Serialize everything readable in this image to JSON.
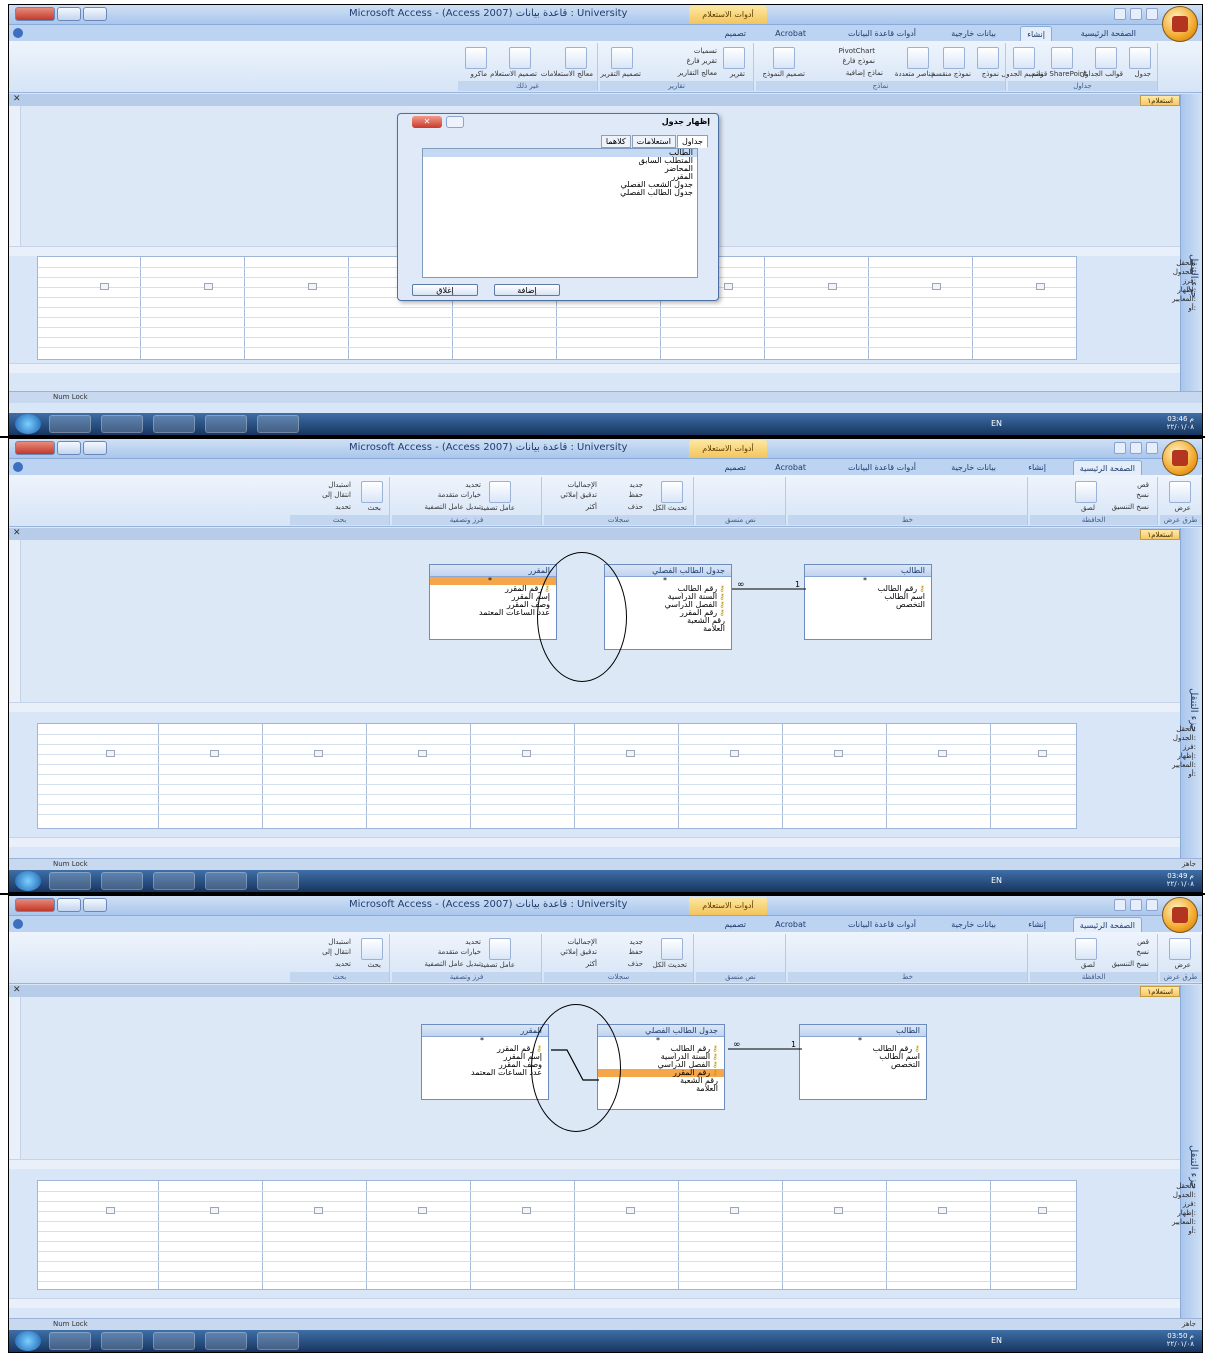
{
  "window": {
    "title": "Microsoft Access - (Access 2007) قاعدة بيانات : University",
    "context_tab": "أدوات الاستعلام"
  },
  "tabs": [
    "الصفحة الرئيسية",
    "إنشاء",
    "بيانات خارجية",
    "أدوات قاعدة البيانات",
    "Acrobat",
    "تصميم"
  ],
  "ribbon_create": {
    "groups": [
      "جداول",
      "نماذج",
      "تقارير",
      "غير ذلك"
    ],
    "buttons": [
      "جدول",
      "قوالب الجداول",
      "قوائم SharePoint",
      "تصميم الجدول",
      "نموذج",
      "نموذج منقسم",
      "عناصر متعددة",
      "تصميم النموذج",
      "PivotChart",
      "نموذج فارغ",
      "نماذج إضافية",
      "تقرير",
      "تسميات",
      "تقرير فارغ",
      "معالج التقارير",
      "تصميم التقرير",
      "معالج الاستعلامات",
      "تصميم الاستعلام",
      "ماكرو"
    ]
  },
  "ribbon_home": {
    "groups": [
      "طرق عرض",
      "الحافظة",
      "خط",
      "نص منسق",
      "سجلات",
      "فرز وتصفية",
      "بحث"
    ],
    "buttons": [
      "عرض",
      "لصق",
      "قص",
      "نسخ",
      "نسخ التنسيق",
      "تحديث الكل",
      "جديد",
      "حفظ",
      "حذف",
      "الإجماليات",
      "تدقيق إملائي",
      "أكثر",
      "عامل تصفية",
      "تحديد",
      "خيارات متقدمة",
      "تبديل عامل التصفية",
      "بحث",
      "استبدال",
      "انتقال إلى",
      "تحديد"
    ]
  },
  "doc_tab": "استعلام١",
  "nav_pane": "جزء التنقل",
  "grid_labels": [
    "الحقل:",
    "الجدول:",
    "فرز:",
    "إظهار:",
    "المعايير:",
    "أو:"
  ],
  "dialog": {
    "title": "إظهار جدول",
    "tabs": [
      "جداول",
      "استعلامات",
      "كلاهما"
    ],
    "items": [
      "الطالب",
      "المتطلب السابق",
      "المحاضر",
      "المقرر",
      "جدول الشعب الفصلي",
      "جدول الطالب الفصلي"
    ],
    "add_button": "إضافة",
    "close_button": "إغلاق"
  },
  "tables": {
    "student": {
      "title": "الطالب",
      "fields": [
        "*",
        "رقم الطالب",
        "اسم الطالب",
        "التخصص"
      ]
    },
    "semester": {
      "title": "جدول الطالب الفصلي",
      "fields": [
        "*",
        "رقم الطالب",
        "السنة الدراسية",
        "الفصل الدراسي",
        "رقم المقرر",
        "رقم الشعبة",
        "العلامة"
      ]
    },
    "course": {
      "title": "المقرر",
      "fields": [
        "*",
        "رقم المقرر",
        "إسم المقرر",
        "وصف المقرر",
        "عدد الساعات المعتمد"
      ]
    }
  },
  "relationship": {
    "one": "1",
    "many": "∞"
  },
  "status": {
    "left": "Num Lock",
    "ready": "جاهز"
  },
  "taskbar": {
    "lang": "EN",
    "times": [
      "03:46 م",
      "03:49 م",
      "03:50 م"
    ],
    "date": "٢٢/٠١/٠٨"
  }
}
